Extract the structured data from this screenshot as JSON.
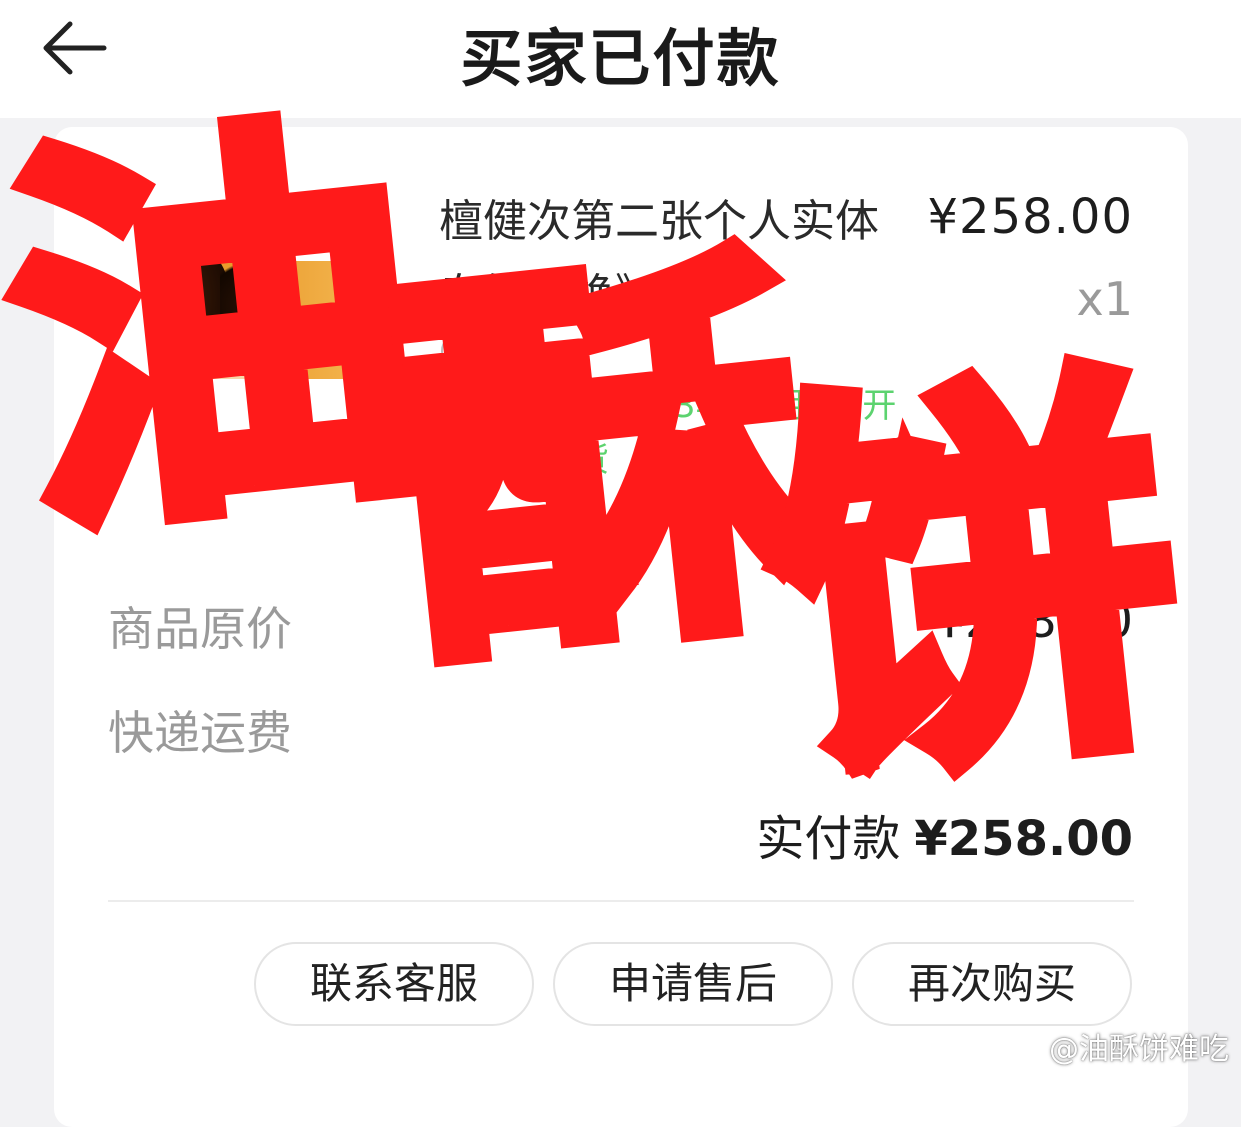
{
  "header": {
    "title": "买家已付款"
  },
  "order": {
    "product_name": "檀健次第二张个人实体专辑《焕》",
    "presale_note": "预售，预计2023年12月7日开始陆续发货",
    "price": "¥258.00",
    "quantity": "x1"
  },
  "summary": {
    "original_price_label": "商品原价",
    "original_price_value": "¥258.00",
    "shipping_label": "快递运费",
    "shipping_value": "¥0",
    "paid_label": "实付款",
    "paid_value": "¥258.00"
  },
  "actions": {
    "contact_service": "联系客服",
    "after_sales": "申请售后",
    "buy_again": "再次购买"
  },
  "overlay": {
    "watermark_text": "油酥饼",
    "watermark_color": "#ff1a1a",
    "credit": "@油酥饼难吃"
  },
  "colors": {
    "presale_green": "#5cd36f",
    "muted_gray": "#9a9a9a"
  },
  "icons": {
    "back": "back-arrow-icon",
    "spec": "spec-circle-icon",
    "weibo": "weibo-logo-icon"
  }
}
